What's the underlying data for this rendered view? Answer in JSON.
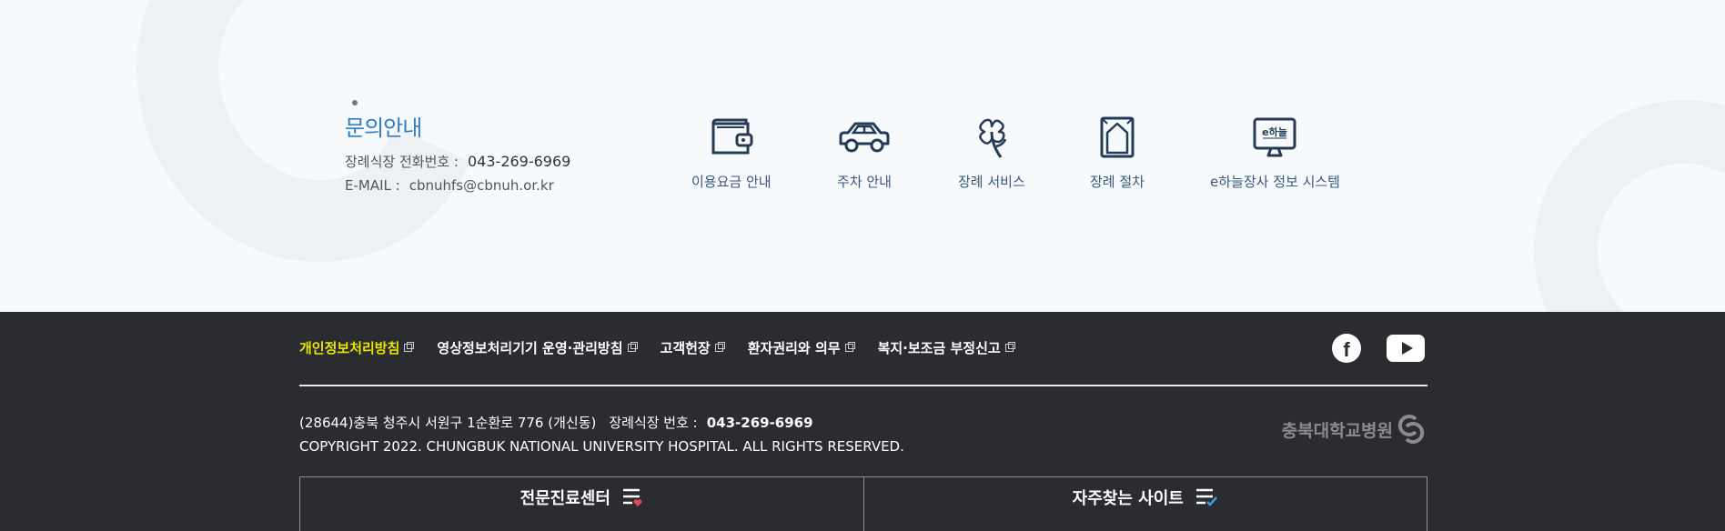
{
  "contact": {
    "title": "문의안내",
    "phone_label": "장례식장 전화번호 :",
    "phone": "043-269-6969",
    "email_label": "E-MAIL :",
    "email": "cbnuhfs@cbnuh.or.kr"
  },
  "quick_links": [
    {
      "label": "이용요금 안내",
      "icon": "wallet-icon"
    },
    {
      "label": "주차 안내",
      "icon": "car-icon"
    },
    {
      "label": "장례 서비스",
      "icon": "flower-icon"
    },
    {
      "label": "장례 절차",
      "icon": "frame-icon"
    },
    {
      "label": "e하늘장사 정보 시스템",
      "icon": "monitor-icon"
    }
  ],
  "footer": {
    "links": [
      "개인정보처리방침",
      "영상정보처리기기 운영·관리방침",
      "고객헌장",
      "환자권리와 의무",
      "복지·보조금 부정신고"
    ],
    "address": "(28644)충북 청주시 서원구 1순환로 776 (개신동)",
    "tel_label": "장례식장 번호 :",
    "tel": "043-269-6969",
    "copyright": "COPYRIGHT 2022. CHUNGBUK NATIONAL UNIVERSITY HOSPITAL. ALL RIGHTS RESERVED.",
    "logo_text": "충북대학교병원",
    "box_left": "전문진료센터",
    "box_right": "자주찾는 사이트",
    "highlight_color": "#e6e600"
  }
}
